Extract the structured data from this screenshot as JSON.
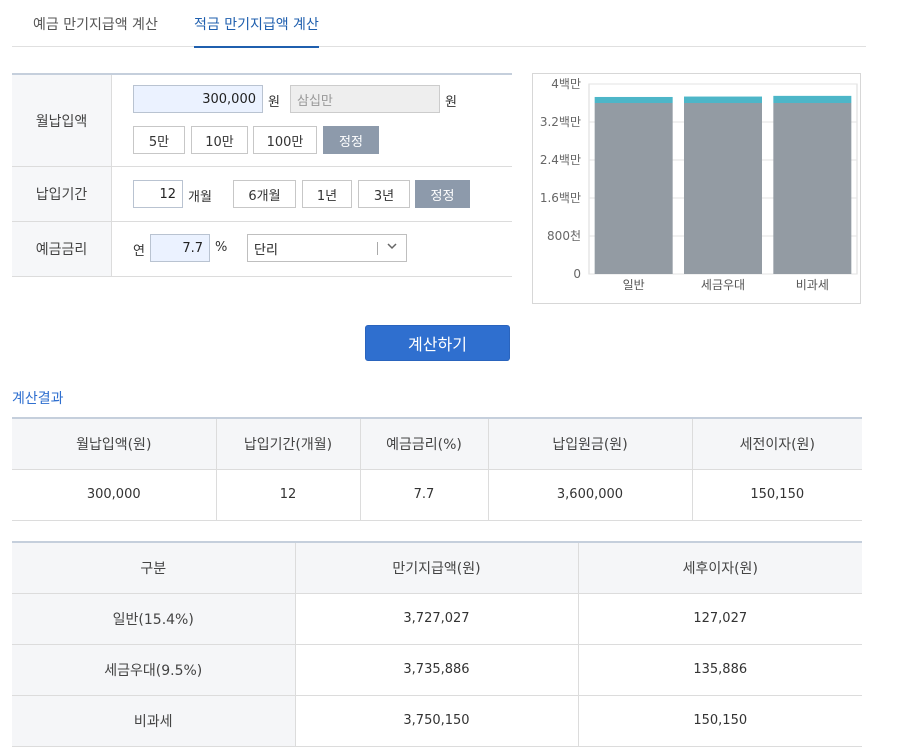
{
  "tabs": [
    {
      "label": "예금 만기지급액 계산",
      "active": false
    },
    {
      "label": "적금 만기지급액 계산",
      "active": true
    }
  ],
  "form": {
    "monthly": {
      "label": "월납입액",
      "value": "300,000",
      "unit": "원",
      "korean_value": "삼십만",
      "korean_unit": "원",
      "buttons": [
        "5만",
        "10만",
        "100만"
      ],
      "correct_label": "정정"
    },
    "period": {
      "label": "납입기간",
      "value": "12",
      "unit": "개월",
      "buttons": [
        "6개월",
        "1년",
        "3년"
      ],
      "correct_label": "정정"
    },
    "rate": {
      "label": "예금금리",
      "prefix": "연",
      "value": "7.7",
      "unit": "%",
      "type_selected": "단리"
    }
  },
  "calculate_label": "계산하기",
  "result_title": "계산결과",
  "result_summary": {
    "headers": [
      "월납입액(원)",
      "납입기간(개월)",
      "예금금리(%)",
      "납입원금(원)",
      "세전이자(원)"
    ],
    "row": [
      "300,000",
      "12",
      "7.7",
      "3,600,000",
      "150,150"
    ]
  },
  "result_detail": {
    "headers": [
      "구분",
      "만기지급액(원)",
      "세후이자(원)"
    ],
    "rows": [
      [
        "일반(15.4%)",
        "3,727,027",
        "127,027"
      ],
      [
        "세금우대(9.5%)",
        "3,735,886",
        "135,886"
      ],
      [
        "비과세",
        "3,750,150",
        "150,150"
      ]
    ]
  },
  "chart_data": {
    "type": "bar",
    "stacked": true,
    "categories": [
      "일반",
      "세금우대",
      "비과세"
    ],
    "series": [
      {
        "values": [
          3600000,
          3600000,
          3600000
        ],
        "color": "#939ba3"
      },
      {
        "values": [
          127027,
          135886,
          150150
        ],
        "color": "#4db6c8"
      }
    ],
    "ylim": [
      0,
      4000000
    ],
    "yticks": [
      0,
      800000,
      1600000,
      2400000,
      3200000,
      4000000
    ],
    "ytick_labels": [
      "0",
      "800천",
      "1.6백만",
      "2.4백만",
      "3.2백만",
      "4백만"
    ],
    "grid": true,
    "xlabel": "",
    "ylabel": "",
    "title": ""
  }
}
